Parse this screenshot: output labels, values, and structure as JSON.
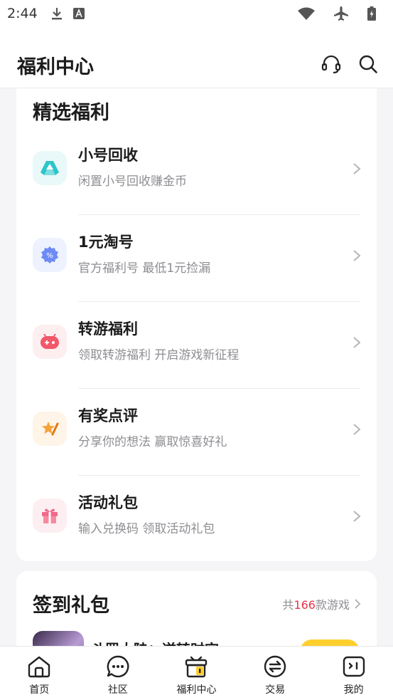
{
  "status": {
    "time": "2:44",
    "icons": [
      "download-icon",
      "font-a-icon",
      "wifi-icon",
      "airplane-icon",
      "battery-charging-icon"
    ]
  },
  "header": {
    "title": "福利中心",
    "icons": [
      "headset-icon",
      "search-icon"
    ]
  },
  "benefits": {
    "title": "精选福利",
    "items": [
      {
        "icon": "recycle-triangle-icon",
        "title": "小号回收",
        "subtitle": "闲置小号回收赚金币",
        "icon_color": "#2ec5c9",
        "icon_bg": "#e9f8f8"
      },
      {
        "icon": "percent-badge-icon",
        "title": "1元淘号",
        "subtitle": "官方福利号 最低1元捡漏",
        "icon_color": "#5b7cf2",
        "icon_bg": "#eef2fe"
      },
      {
        "icon": "gamepad-icon",
        "title": "转游福利",
        "subtitle": "领取转游福利 开启游戏新征程",
        "icon_color": "#f2576a",
        "icon_bg": "#fdeef0"
      },
      {
        "icon": "review-star-icon",
        "title": "有奖点评",
        "subtitle": "分享你的想法 赢取惊喜好礼",
        "icon_color": "#f5a23a",
        "icon_bg": "#fef4e7"
      },
      {
        "icon": "gift-icon",
        "title": "活动礼包",
        "subtitle": "输入兑换码 领取活动礼包",
        "icon_color": "#f06a8a",
        "icon_bg": "#fdeef2"
      }
    ]
  },
  "checkin": {
    "title": "签到礼包",
    "more_prefix": "共",
    "more_count": "166",
    "more_suffix": "款游戏",
    "game_name": "斗罗大陆：逆转时空"
  },
  "tabs": [
    {
      "label": "首页",
      "icon": "home-icon"
    },
    {
      "label": "社区",
      "icon": "chat-bubble-icon"
    },
    {
      "label": "福利中心",
      "icon": "welfare-box-icon",
      "active": true
    },
    {
      "label": "交易",
      "icon": "exchange-icon"
    },
    {
      "label": "我的",
      "icon": "profile-face-icon"
    }
  ],
  "colors": {
    "accent": "#ffcf2e",
    "count_red": "#e8364a",
    "text_primary": "#1b1b1b",
    "text_secondary": "#8e8e93"
  }
}
